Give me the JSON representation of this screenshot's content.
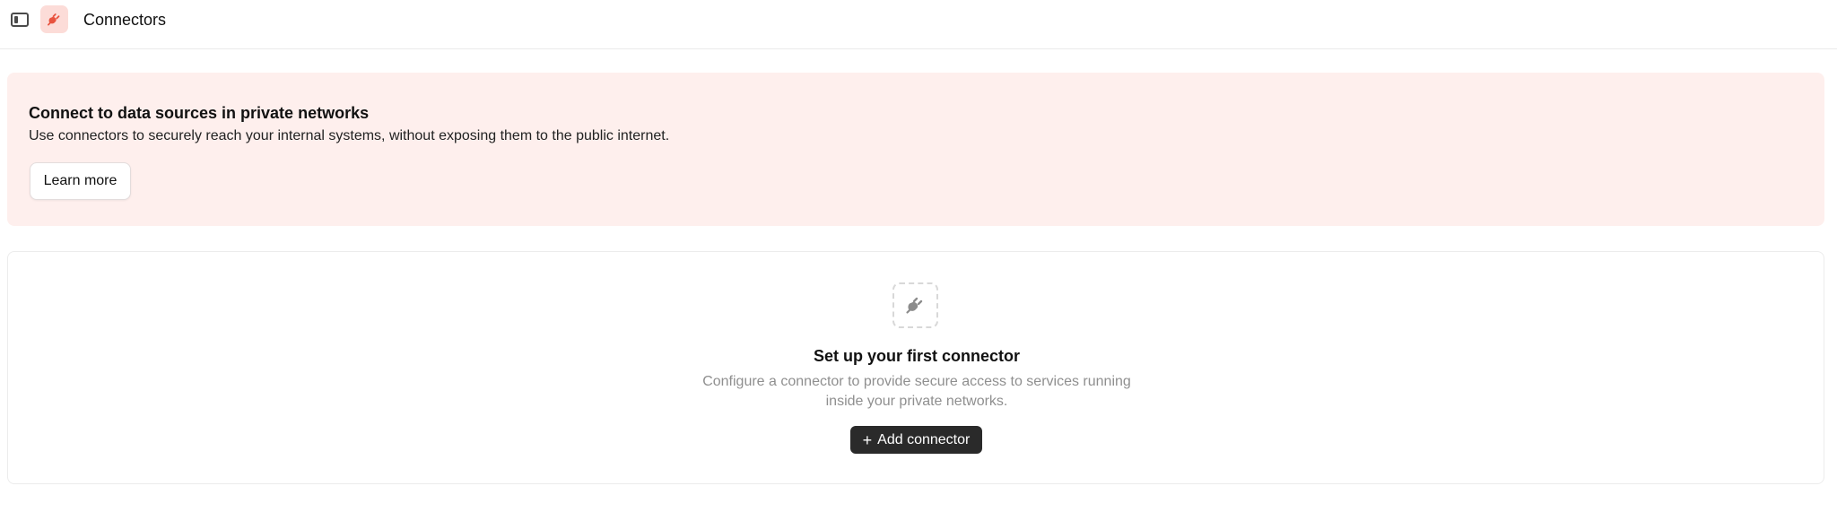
{
  "header": {
    "title": "Connectors",
    "toggle_icon": "sidebar-toggle-icon",
    "app_icon": "plug-icon",
    "app_icon_bg": "#fcdcd8",
    "app_icon_color": "#e8533f"
  },
  "banner": {
    "title": "Connect to data sources in private networks",
    "description": "Use connectors to securely reach your internal systems, without exposing them to the public internet.",
    "learn_more_label": "Learn more",
    "background": "#feefed"
  },
  "empty_state": {
    "icon": "plug-icon",
    "title": "Set up your first connector",
    "description": "Configure a connector to provide secure access to services running inside your private networks.",
    "button_label": "Add connector",
    "button_icon": "plus-icon",
    "button_background": "#2a2a2a"
  }
}
